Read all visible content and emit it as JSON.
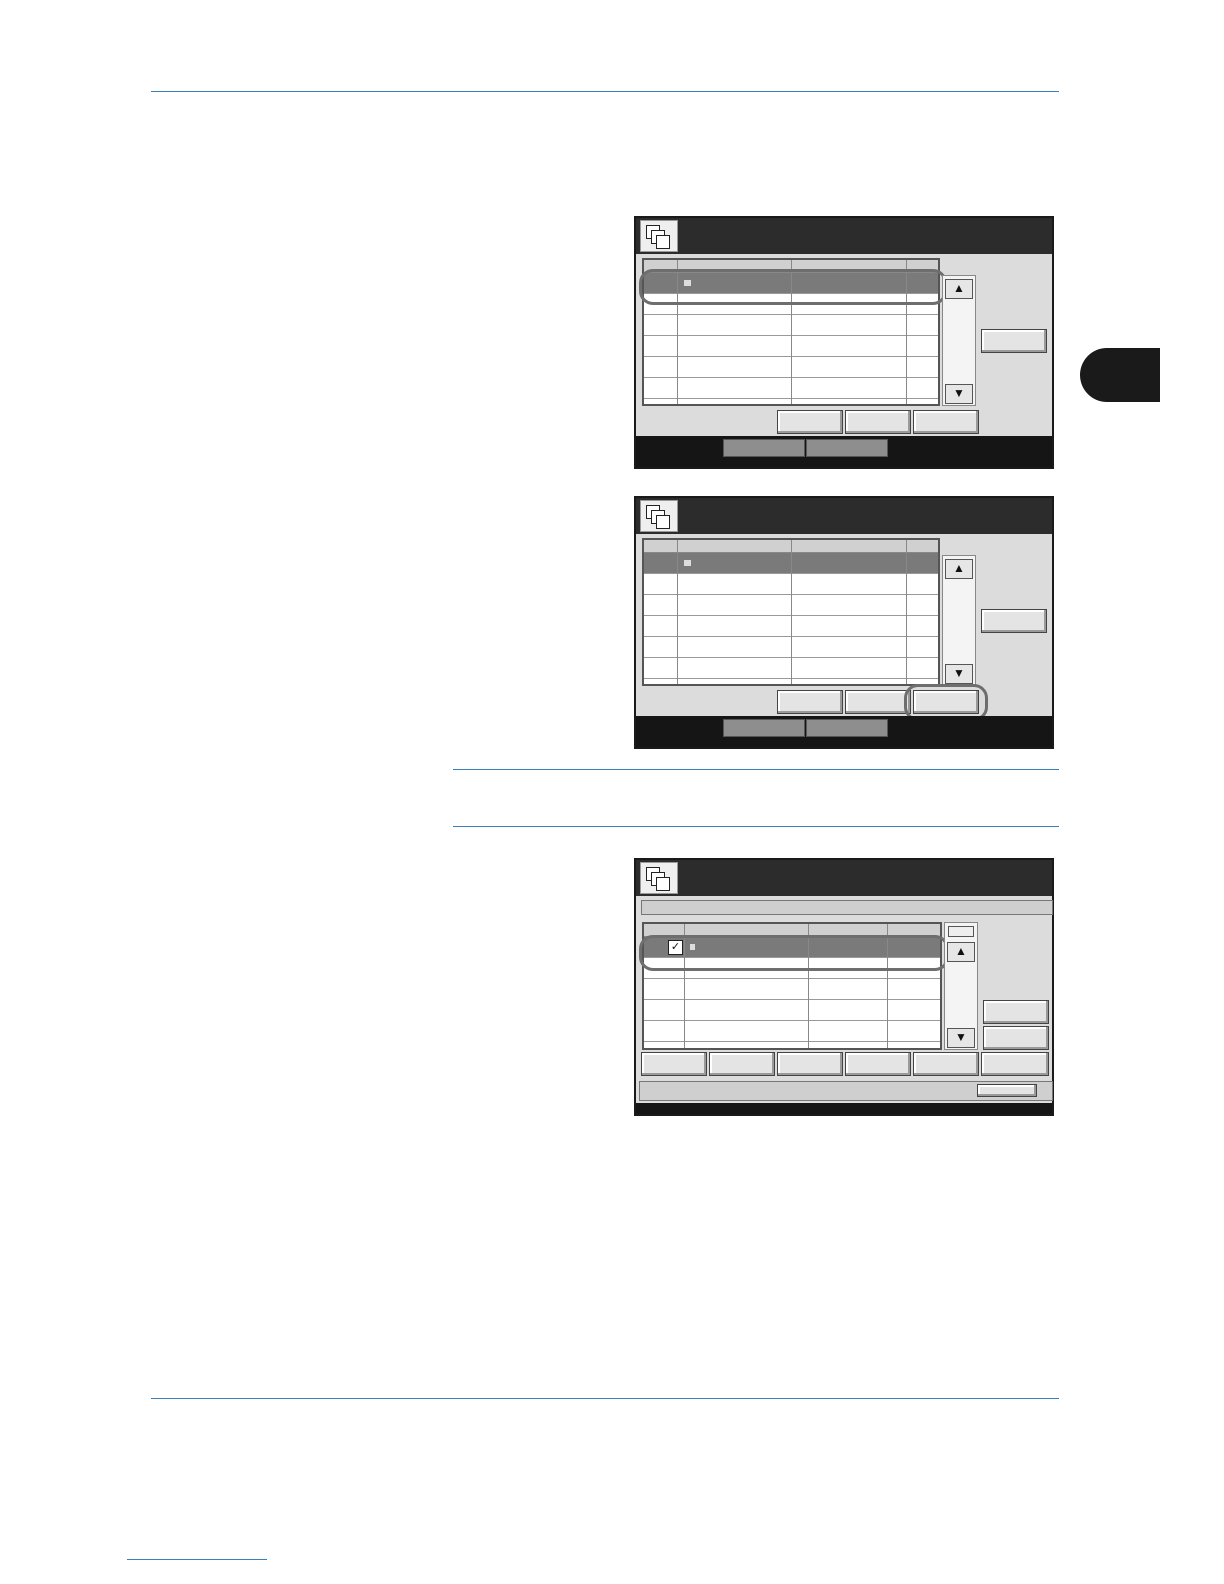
{
  "document": {
    "header_rule": true,
    "chapter_tab": true,
    "footer_rule": true
  },
  "screens": [
    {
      "icon": "document-box-icon",
      "highlighted": "first-list-row"
    },
    {
      "icon": "document-box-icon",
      "highlighted": "third-action-button"
    },
    {
      "icon": "document-box-icon",
      "highlighted": "first-checked-row"
    }
  ],
  "colors": {
    "accent_rule": "#3a7fb5",
    "panel_dark": "#2c2c2c",
    "selected_row": "#7a7a7a"
  }
}
